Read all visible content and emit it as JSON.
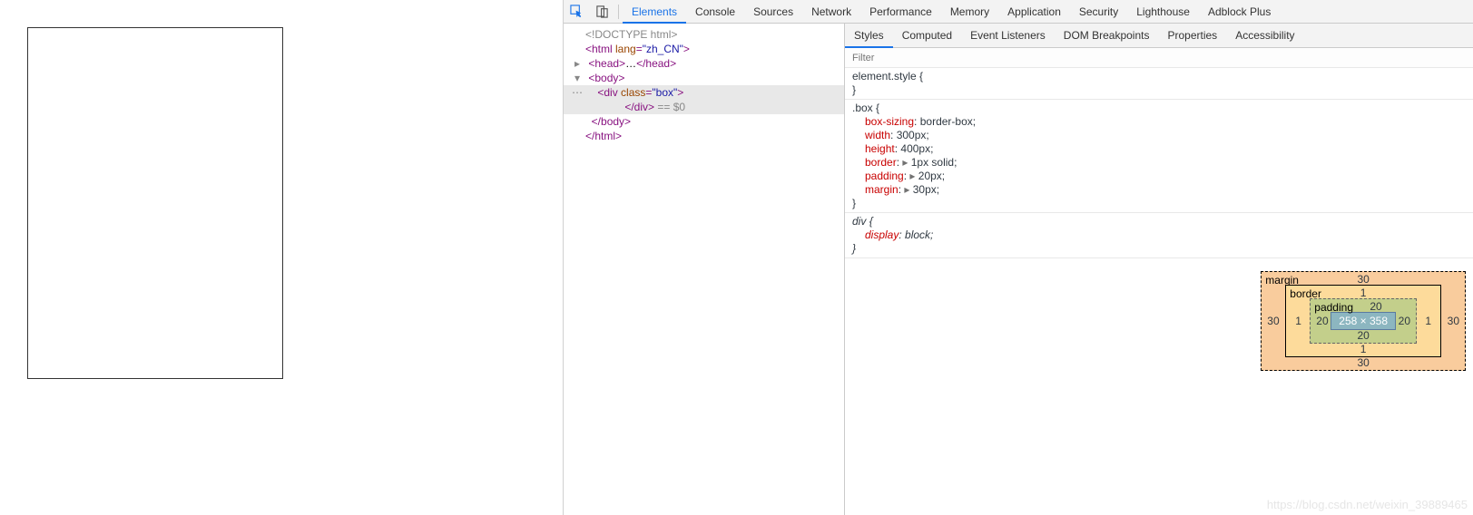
{
  "main_tabs": [
    "Elements",
    "Console",
    "Sources",
    "Network",
    "Performance",
    "Memory",
    "Application",
    "Security",
    "Lighthouse",
    "Adblock Plus"
  ],
  "main_tab_active_index": 0,
  "sub_tabs": [
    "Styles",
    "Computed",
    "Event Listeners",
    "DOM Breakpoints",
    "Properties",
    "Accessibility"
  ],
  "sub_tab_active_index": 0,
  "filter_placeholder": "Filter",
  "dom": {
    "l0": "<!DOCTYPE html>",
    "l1_open": "<html ",
    "l1_attr": "lang",
    "l1_val": "\"zh_CN\"",
    "l1_close": ">",
    "l2": "<head>",
    "l2b": "…",
    "l2c": "</head>",
    "l3": "<body>",
    "l4_open": "<div ",
    "l4_attr": "class",
    "l4_val": "\"box\"",
    "l4_close": ">",
    "l5": "</div>",
    "l5_ref": " == $0",
    "l6": "</body>",
    "l7": "</html>"
  },
  "rules": [
    {
      "selector": "element.style ",
      "decls": []
    },
    {
      "selector": ".box ",
      "decls": [
        {
          "name": "box-sizing",
          "value": "border-box;",
          "tri": false
        },
        {
          "name": "width",
          "value": "300px;",
          "tri": false
        },
        {
          "name": "height",
          "value": "400px;",
          "tri": false
        },
        {
          "name": "border",
          "value": "1px solid;",
          "tri": true
        },
        {
          "name": "padding",
          "value": "20px;",
          "tri": true
        },
        {
          "name": "margin",
          "value": "30px;",
          "tri": true
        }
      ]
    },
    {
      "selector": "div ",
      "decls": [
        {
          "name": "display",
          "value": "block;",
          "tri": false
        }
      ],
      "ua": true
    }
  ],
  "box_model": {
    "margin": {
      "label": "margin",
      "t": "30",
      "r": "30",
      "b": "30",
      "l": "30"
    },
    "border": {
      "label": "border",
      "t": "1",
      "r": "1",
      "b": "1",
      "l": "1"
    },
    "padding": {
      "label": "padding",
      "t": "20",
      "r": "20",
      "b": "20",
      "l": "20"
    },
    "content": "258 × 358"
  },
  "watermark": "https://blog.csdn.net/weixin_39889465"
}
